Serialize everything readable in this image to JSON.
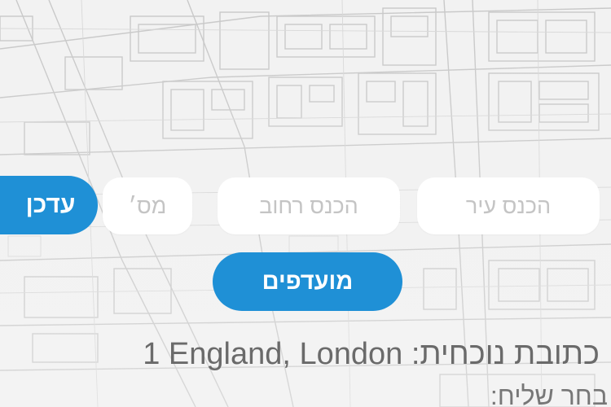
{
  "address_form": {
    "city_placeholder": "הכנס עיר",
    "street_placeholder": "הכנס רחוב",
    "number_placeholder": "מס׳",
    "update_label": "עדכן",
    "favorites_label": "מועדפים"
  },
  "current_address": {
    "label": "כתובת נוכחית:",
    "value": "1 England, London"
  },
  "courier": {
    "prompt": "בחר שליח:"
  },
  "colors": {
    "accent": "#1f90d6",
    "field_background": "#ffffff",
    "placeholder": "#c4c4c4",
    "text_gray": "#6a6a6a"
  }
}
